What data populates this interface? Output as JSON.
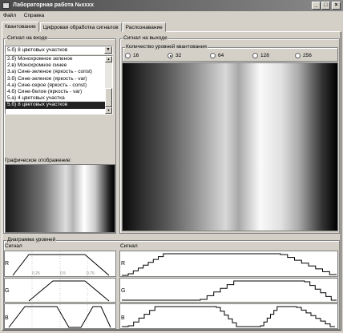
{
  "window": {
    "title": "Лабораторная работа №хххх",
    "controls": [
      "_",
      "□",
      "×"
    ]
  },
  "menu": [
    "Файл",
    "Справка"
  ],
  "tabs": [
    {
      "label": "Квантование",
      "active": true
    },
    {
      "label": "Цифровая обработка сигналов",
      "active": false
    },
    {
      "label": "Распознавание",
      "active": false
    }
  ],
  "input_group": {
    "title": "Сигнал на входе",
    "combo_value": "5.б) 8 цветовых участков",
    "list": [
      "2.б) Монохромное зеленое",
      "2.в) Монохромное синее",
      "3.а) Сине-зеленое (яркость - const)",
      "3.б) Сине-зеленое (яркость - var)",
      "4.а) Сине-серое (яркость - const)",
      "4.б) Сине-белое (яркость - var)",
      "5.а) 4 цветовых участка",
      "5.б) 8 цветовых участков"
    ],
    "selected_index": 7,
    "graphic_title": "Графическое отображение:"
  },
  "output_group": {
    "title": "Сигнал на выходе",
    "levels_title": "Количество уровней квантования",
    "levels": [
      "16",
      "32",
      "64",
      "128",
      "256"
    ],
    "selected_level": "32"
  },
  "diagram": {
    "title": "Диаграмма уровней",
    "left_title": "Сигнал",
    "right_title": "Сигнал",
    "channels": [
      "R",
      "G",
      "B"
    ],
    "tick_labels": [
      "0.25",
      "0.5",
      "0.75"
    ]
  }
}
